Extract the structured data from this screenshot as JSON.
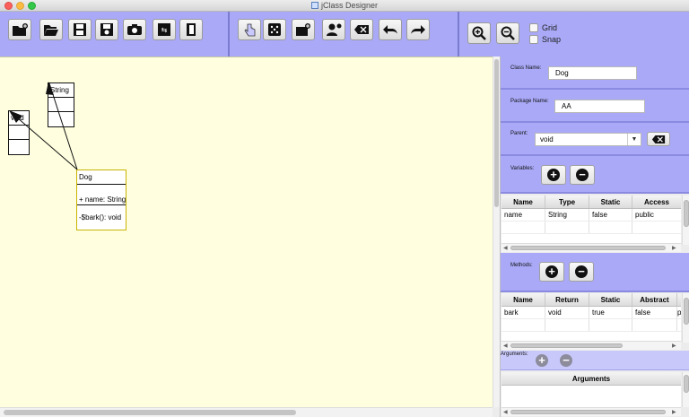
{
  "window": {
    "title": "jClass Designer"
  },
  "toolbar": {
    "file_icons": [
      "new-folder-icon",
      "open-folder-icon",
      "save-icon",
      "save-as-icon",
      "camera-icon",
      "export-icon",
      "exit-icon"
    ],
    "edit_icons": [
      "hand-pointer-icon",
      "dice-icon",
      "add-class-icon",
      "add-user-icon",
      "delete-icon",
      "undo-icon",
      "redo-icon"
    ],
    "zoom_icons": [
      "zoom-in-icon",
      "zoom-out-icon"
    ],
    "grid_label": "Grid",
    "snap_label": "Snap",
    "accent": "#a9a9f7"
  },
  "canvas": {
    "background": "#ffffe0",
    "classes": [
      {
        "name": "void",
        "rows": [
          "void",
          "",
          ""
        ]
      },
      {
        "name": "String",
        "rows": [
          "String",
          "",
          ""
        ]
      },
      {
        "name": "Dog",
        "rows": [
          "Dog",
          "",
          "+ name: String",
          "",
          "-$bark(): void"
        ]
      }
    ]
  },
  "panel": {
    "class_name_label": "Class Name:",
    "class_name_value": "Dog",
    "package_name_label": "Package Name:",
    "package_name_value": "AA",
    "parent_label": "Parent:",
    "parent_value": "void",
    "variables_label": "Variables:",
    "methods_label": "Methods:",
    "arguments_label": "Arguments:",
    "variables_table": {
      "headers": [
        "Name",
        "Type",
        "Static",
        "Access"
      ],
      "rows": [
        [
          "name",
          "String",
          "false",
          "public"
        ]
      ]
    },
    "methods_table": {
      "headers": [
        "Name",
        "Return",
        "Static",
        "Abstract"
      ],
      "rows": [
        [
          "bark",
          "void",
          "true",
          "false",
          "p"
        ]
      ]
    },
    "arguments_table": {
      "headers": [
        "Arguments"
      ]
    }
  }
}
